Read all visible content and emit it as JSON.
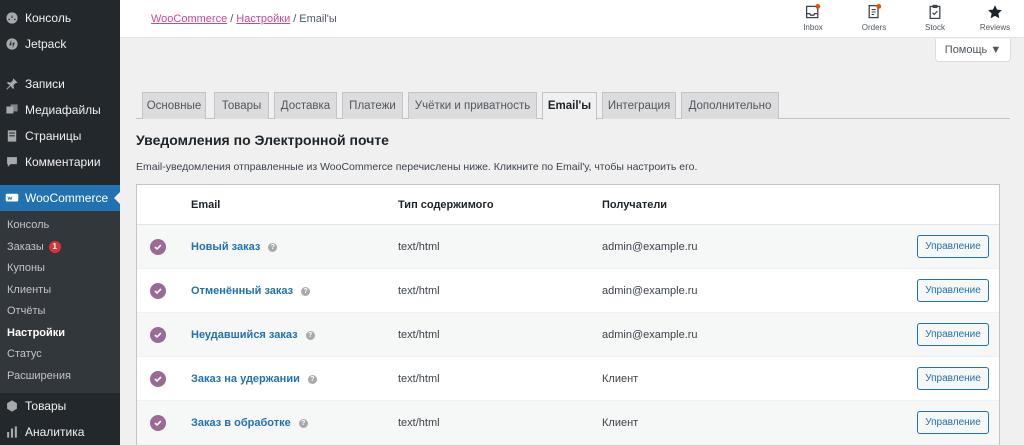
{
  "sidebar": {
    "items_top": [
      {
        "label": "Консоль",
        "icon": "dashboard-icon"
      },
      {
        "label": "Jetpack",
        "icon": "jetpack-icon"
      }
    ],
    "items_mid": [
      {
        "label": "Записи",
        "icon": "pin-icon"
      },
      {
        "label": "Медиафайлы",
        "icon": "media-icon"
      },
      {
        "label": "Страницы",
        "icon": "page-icon"
      },
      {
        "label": "Комментарии",
        "icon": "comment-icon"
      }
    ],
    "woocommerce": {
      "label": "WooCommerce",
      "icon": "woocommerce-icon"
    },
    "submenu": [
      {
        "label": "Консоль"
      },
      {
        "label": "Заказы",
        "badge": "1"
      },
      {
        "label": "Купоны"
      },
      {
        "label": "Клиенты"
      },
      {
        "label": "Отчёты"
      },
      {
        "label": "Настройки",
        "current": true
      },
      {
        "label": "Статус"
      },
      {
        "label": "Расширения"
      }
    ],
    "items_bottom": [
      {
        "label": "Товары",
        "icon": "box-icon"
      },
      {
        "label": "Аналитика",
        "icon": "chart-icon"
      }
    ]
  },
  "breadcrumb": {
    "root": "WooCommerce",
    "parent": "Настройки",
    "current": "Email'ы",
    "separator": "/"
  },
  "top_actions": [
    {
      "label": "Inbox",
      "icon": "inbox-icon"
    },
    {
      "label": "Orders",
      "icon": "orders-icon"
    },
    {
      "label": "Stock",
      "icon": "stock-icon"
    },
    {
      "label": "Reviews",
      "icon": "star-icon"
    }
  ],
  "help": {
    "label": "Помощь ▼"
  },
  "tabs": [
    {
      "label": "Основные"
    },
    {
      "label": "Товары"
    },
    {
      "label": "Доставка"
    },
    {
      "label": "Платежи"
    },
    {
      "label": "Учётки и приватность"
    },
    {
      "label": "Email'ы",
      "active": true
    },
    {
      "label": "Интеграция"
    },
    {
      "label": "Дополнительно"
    }
  ],
  "section": {
    "title": "Уведомления по Электронной почте",
    "description": "Email-уведомления отправленные из WooCommerce перечислены ниже. Кликните по Email'у, чтобы настроить его."
  },
  "table": {
    "headers": {
      "email": "Email",
      "content_type": "Тип содержимого",
      "recipients": "Получатели"
    },
    "manage_label": "Управление",
    "help_glyph": "?",
    "rows": [
      {
        "name": "Новый заказ",
        "type": "text/html",
        "recipient": "admin@example.ru"
      },
      {
        "name": "Отменённый заказ",
        "type": "text/html",
        "recipient": "admin@example.ru"
      },
      {
        "name": "Неудавшийся заказ",
        "type": "text/html",
        "recipient": "admin@example.ru"
      },
      {
        "name": "Заказ на удержании",
        "type": "text/html",
        "recipient": "Клиент"
      },
      {
        "name": "Заказ в обработке",
        "type": "text/html",
        "recipient": "Клиент"
      }
    ]
  },
  "colors": {
    "sidebar_bg": "#23282d",
    "active_menu": "#2271b1",
    "link": "#2271b1",
    "breadcrumb_link": "#c94b8c",
    "check_purple": "#9a6a97",
    "notification_dot": "#e65100"
  }
}
